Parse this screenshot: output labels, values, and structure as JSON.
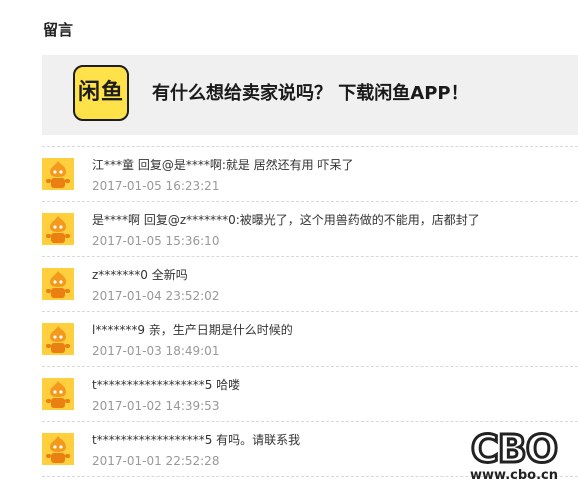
{
  "section": {
    "title": "留言"
  },
  "banner": {
    "logo_text": "闲鱼",
    "text": "有什么想给卖家说吗？ 下载闲鱼APP！"
  },
  "comments": [
    {
      "avatar": "orange-mascot-icon",
      "text": "江***童  回复@是****啊:就是 居然还有用 吓呆了",
      "time": "2017-01-05 16:23:21"
    },
    {
      "avatar": "orange-mascot-icon",
      "text": "是****啊  回复@z*******0:被曝光了，这个用兽药做的不能用，店都封了",
      "time": "2017-01-05 15:36:10"
    },
    {
      "avatar": "orange-mascot-icon",
      "text": "z*******0  全新吗",
      "time": "2017-01-04 23:52:02"
    },
    {
      "avatar": "orange-mascot-icon",
      "text": "l*******9  亲，生产日期是什么时候的",
      "time": "2017-01-03 18:49:01"
    },
    {
      "avatar": "orange-mascot-icon",
      "text": "t******************5  哈喽",
      "time": "2017-01-02 14:39:53"
    },
    {
      "avatar": "orange-mascot-icon",
      "text": "t******************5  有吗。请联系我",
      "time": "2017-01-01 22:52:28"
    }
  ],
  "watermark": {
    "letters": "CBO",
    "url": "www.cbo.cn"
  },
  "colors": {
    "avatar_orange": "#f39a1e",
    "avatar_bg": "#ffcf3e",
    "logo_yellow": "#ffe14a",
    "timestamp_gray": "#999999",
    "banner_bg": "#f0f0f0"
  }
}
